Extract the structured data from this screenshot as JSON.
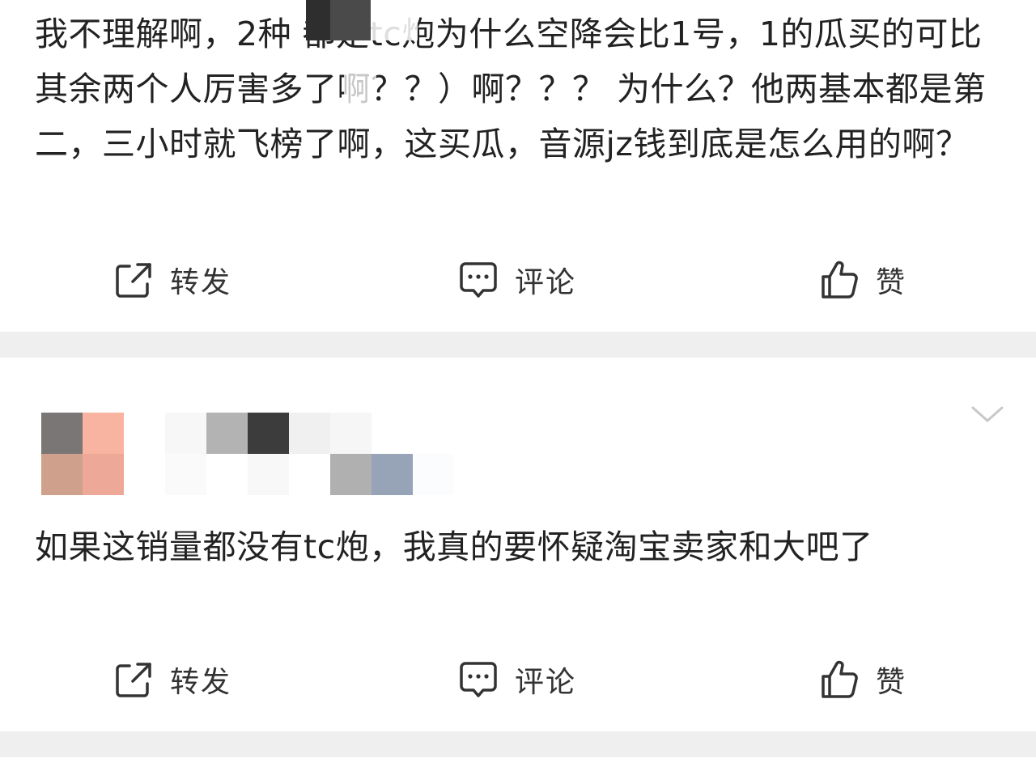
{
  "posts": [
    {
      "text": "我不理解啊，2种 都是tc炮为什么空降会比1号，1的瓜买的可比其余两个人厉害多了啊？？）啊？？？ 为什么？他两基本都是第二，三小时就飞榜了啊，这买瓜，音源jz钱到底是怎么用的啊？",
      "actions": {
        "repost": "转发",
        "comment": "评论",
        "like": "赞"
      }
    },
    {
      "text": "如果这销量都没有tc炮，我真的要怀疑淘宝卖家和大吧了",
      "actions": {
        "repost": "转发",
        "comment": "评论",
        "like": "赞"
      }
    }
  ],
  "icons": {
    "repost": "share-out-icon",
    "comment": "chat-bubble-icon",
    "like": "thumbs-up-icon",
    "more": "chevron-down-icon"
  },
  "colors": {
    "text": "#222222",
    "separator": "#efefef",
    "icon_stroke": "#333333",
    "chevron": "#c8c8c8"
  }
}
